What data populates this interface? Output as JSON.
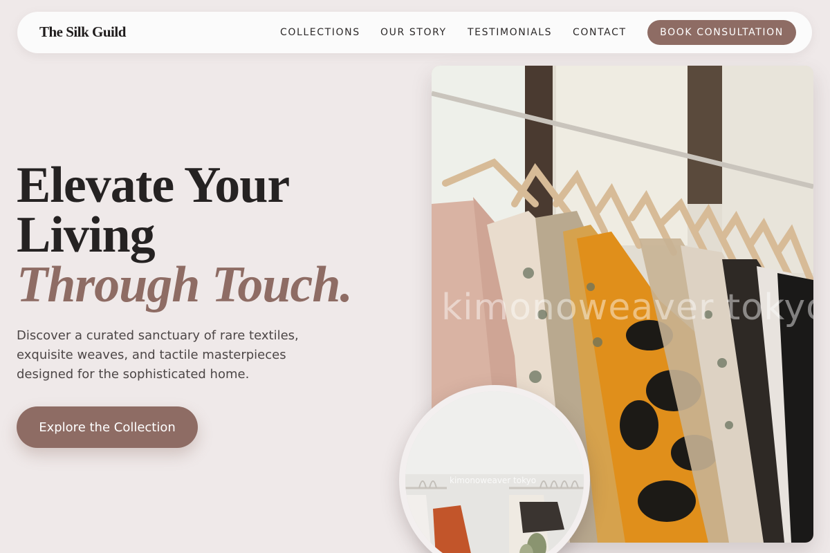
{
  "brand": "The Silk Guild",
  "nav": {
    "links": [
      "COLLECTIONS",
      "OUR STORY",
      "TESTIMONIALS",
      "CONTACT"
    ],
    "cta": "BOOK CONSULTATION"
  },
  "hero": {
    "line1": "Elevate Your",
    "line2": "Living",
    "line3": "Through Touch.",
    "description": "Discover a curated sanctuary of rare textiles, exquisite weaves, and tactile masterpieces designed for the sophisticated home.",
    "cta": "Explore the Collection"
  },
  "images": {
    "main_watermark": "kimonoweaver tokyo",
    "inset_watermark": "kimonoweaver tokyo"
  },
  "colors": {
    "background": "#efe9e9",
    "accent": "#8e6c64",
    "text": "#252222"
  }
}
